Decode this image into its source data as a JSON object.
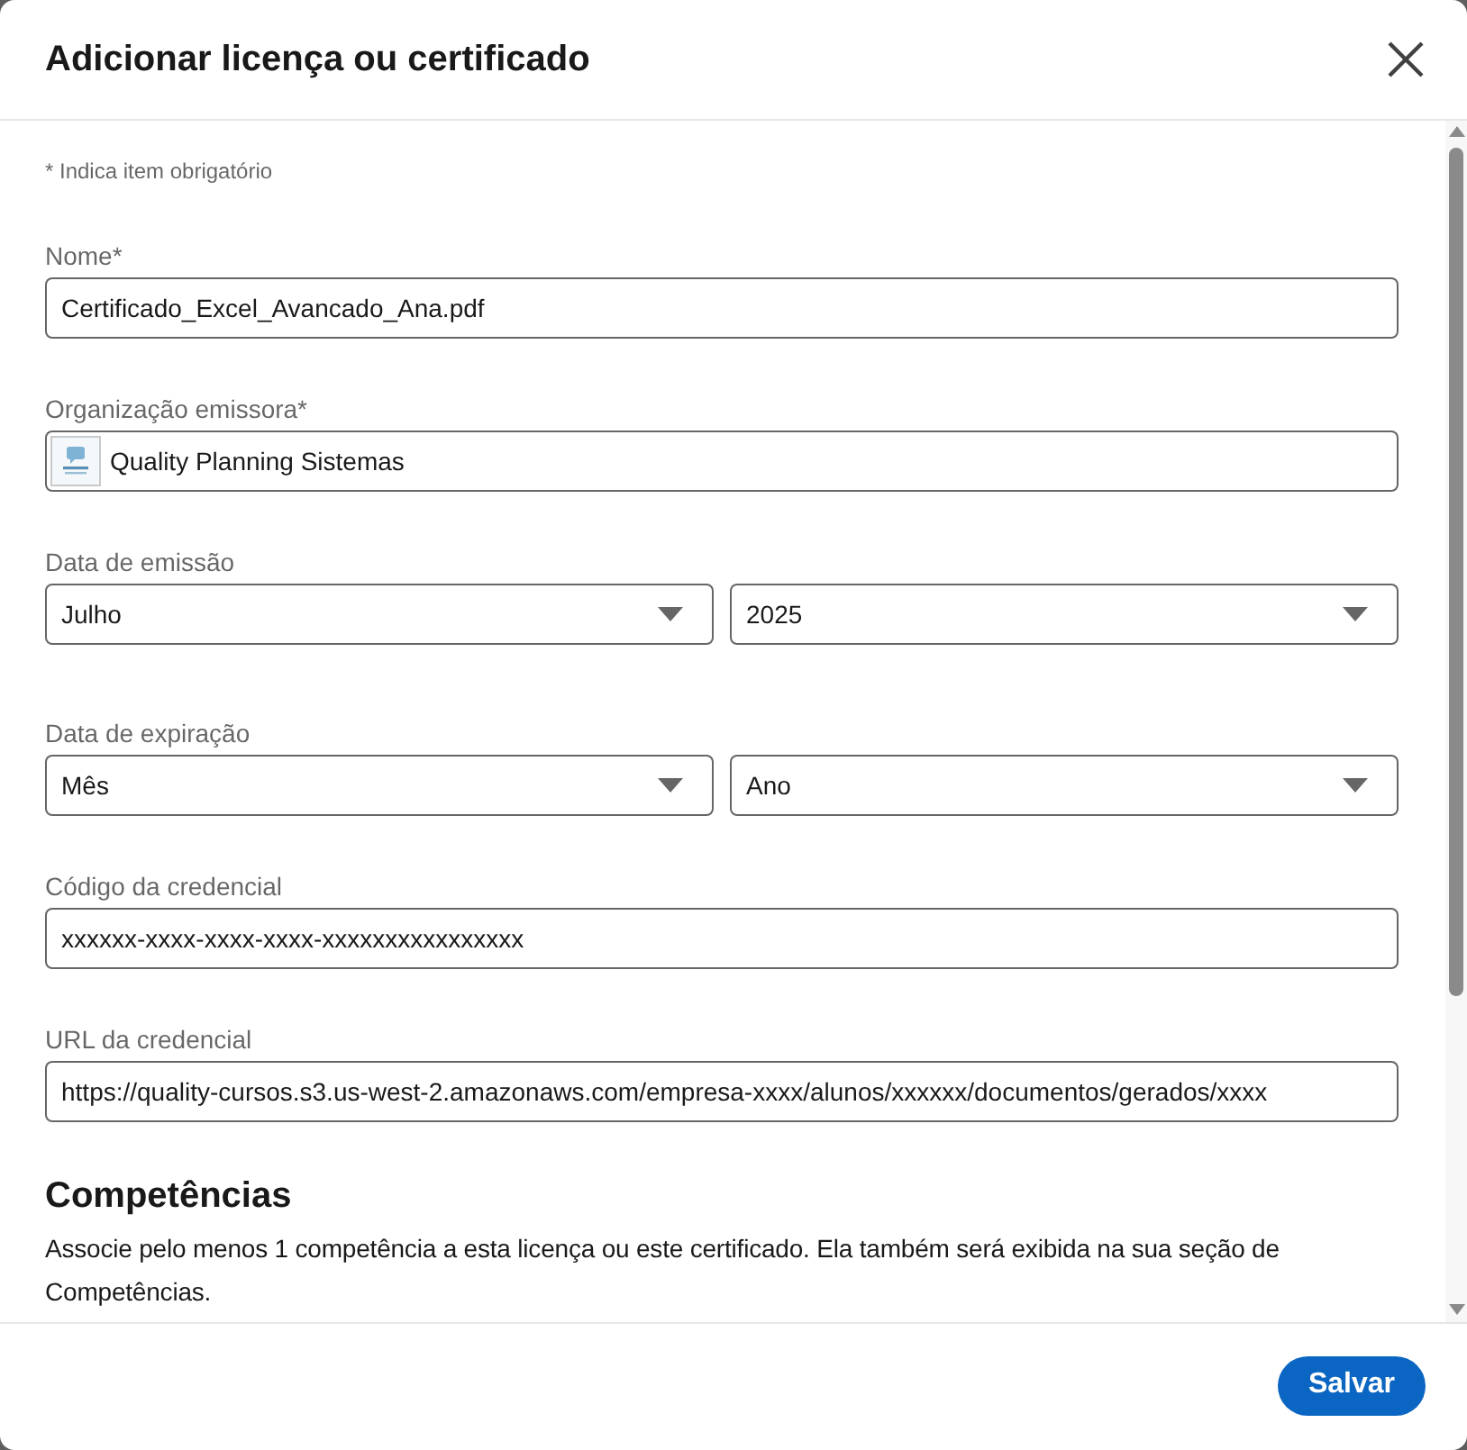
{
  "dialog": {
    "title": "Adicionar licença ou certificado"
  },
  "required_note": "* Indica item obrigatório",
  "fields": [
    {
      "kind": "text",
      "label": "Nome*",
      "value": "Certificado_Excel_Avancado_Ana.pdf"
    },
    {
      "kind": "organization",
      "label": "Organização emissora*",
      "value": "Quality Planning Sistemas"
    },
    {
      "kind": "date",
      "label": "Data de emissão",
      "selects": [
        "Julho",
        "2025"
      ]
    },
    {
      "kind": "date",
      "label": "Data de expiração",
      "selects": [
        "Mês",
        "Ano"
      ]
    },
    {
      "kind": "text",
      "label": "Código da credencial",
      "value": "xxxxxx-xxxx-xxxx-xxxx-xxxxxxxxxxxxxxxx"
    },
    {
      "kind": "text",
      "label": "URL da credencial",
      "value": "https://quality-cursos.s3.us-west-2.amazonaws.com/empresa-xxxx/alunos/xxxxxx/documentos/gerados/xxxx"
    }
  ],
  "skills": {
    "heading": "Competências",
    "description": "Associe pelo menos 1 competência a esta licença ou este certificado. Ela também será exibida na sua seção de Competências."
  },
  "footer": {
    "save_button": "Salvar"
  }
}
